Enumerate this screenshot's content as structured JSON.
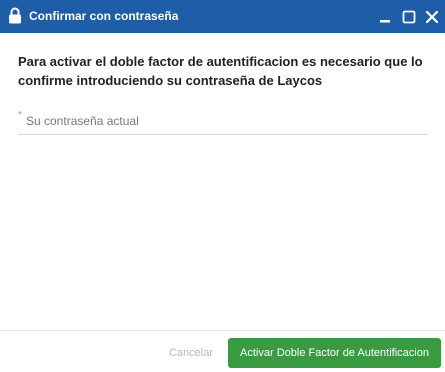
{
  "dialog": {
    "title": "Confirmar con contraseña",
    "title_icon": "lock-icon",
    "window_controls": [
      "minimize-icon",
      "maximize-icon",
      "close-icon"
    ],
    "message": "Para activar el doble factor de autentificacion es necesario que lo confirme introduciendo su contraseña de Laycos",
    "password_field": {
      "required_marker": "*",
      "placeholder": "Su contraseña actual",
      "value": ""
    },
    "buttons": {
      "cancel": "Cancelar",
      "confirm": "Activar Doble Factor de Autentificacion"
    }
  },
  "colors": {
    "titlebar": "#1e5ea8",
    "confirm_button": "#3a9a41",
    "cancel_text": "#b8b8b8"
  }
}
